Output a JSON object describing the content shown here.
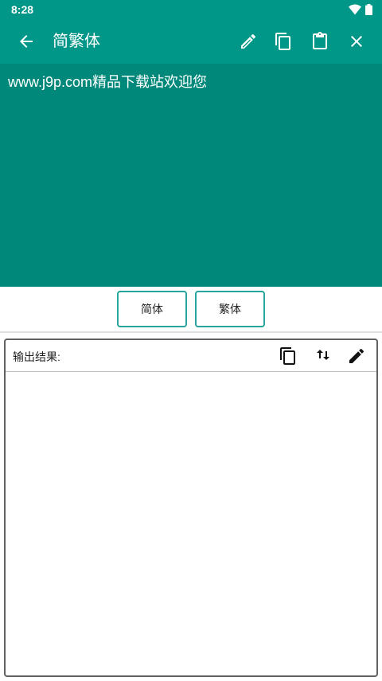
{
  "status_bar": {
    "time": "8:28",
    "icons": [
      "wifi-icon",
      "battery-icon"
    ]
  },
  "toolbar": {
    "title": "简繁体",
    "back_icon": "arrow-left-icon",
    "actions": [
      "edit-icon",
      "copy-icon",
      "paste-icon",
      "close-icon"
    ]
  },
  "input": {
    "text": "www.j9p.com精品下载站欢迎您"
  },
  "buttons": {
    "simplified": "简体",
    "traditional": "繁体"
  },
  "result": {
    "label": "输出结果:",
    "output": "",
    "actions": [
      "copy-icon",
      "swap-vertical-icon",
      "pencil-icon"
    ]
  },
  "colors": {
    "toolbar": "#009688",
    "input_background": "#00897b",
    "button_border": "#26a69a"
  }
}
